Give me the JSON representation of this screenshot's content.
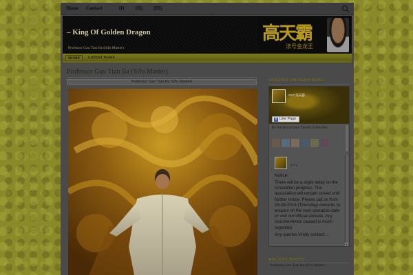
{
  "topnav": {
    "items": [
      "Home",
      "Contact",
      "(I)",
      "(II)",
      "(III)"
    ]
  },
  "header": {
    "title": "–  King Of Golden Dragon",
    "tagline": "Professor Gao Tian Ba (Sifu Master)",
    "logo_chars": "高天霸",
    "logo_sub": "法号金龙王"
  },
  "subnav": {
    "tabs": [
      "HOME",
      "LATEST NEWS"
    ]
  },
  "post": {
    "title": "Professor Gao Tian Ba (Sifu Master)",
    "caption": "Professor Gao Tian Ba (Sifu Master)"
  },
  "sidebar": {
    "heading": "GOLDEN DRAGON KING",
    "fb": {
      "page_name": "GKT 高天霸",
      "like_label": "Like Page",
      "friends_text": "Be the first of your friends to like this",
      "post_time": "3 hrs",
      "notice_title": "Notice:",
      "notice_body": "There will be a slight delay on the renovation progress. The association will remain closed until further notice. Please call us from 08-09-2016 (Thursday) onwards to enquire on the next operation date or visit our official website. Any inconvenience caused is much regretted.",
      "notice_tail": "Any queries kindly contact:..."
    },
    "recent_heading": "RECENT POSTS",
    "recent_items": [
      "Professor Gao Tian Ba (Sifu Master)"
    ]
  },
  "colors": {
    "background": "#8a8a2a",
    "accent": "#6f6d1c",
    "header_bg": "#0b0b0b",
    "gold": "#b89a1c"
  }
}
